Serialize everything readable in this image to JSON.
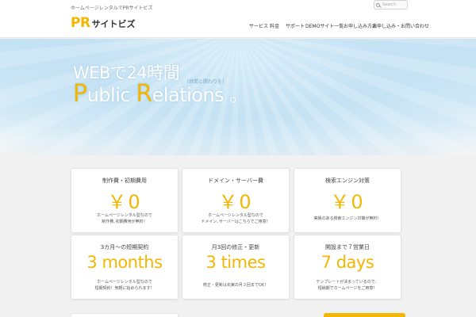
{
  "header": {
    "tagline": "ホームページレンタルでPRサイトビズ",
    "logo_pr": "PR",
    "logo_rest": "サイトビズ",
    "search_placeholder": "Search"
  },
  "nav": {
    "items": [
      {
        "label": "サービス"
      },
      {
        "label": "料金"
      },
      {
        "label": "サポート"
      },
      {
        "label": "DEMOサイト一覧"
      },
      {
        "label": "お申し込み方法"
      },
      {
        "label": "お申し込み・お問い合わせ"
      }
    ]
  },
  "hero": {
    "line1": "WEBで24時間",
    "note": "（世間と関わりを）",
    "line2_p": "P",
    "line2_a": "ublic ",
    "line2_r": "R",
    "line2_b": "elations 。"
  },
  "cards": [
    {
      "title": "制作費・初期費用",
      "value": "￥0",
      "desc1": "ホームページレンタル型なので",
      "desc2": "制作費､初期費用が無料！"
    },
    {
      "title": "ドメイン・サーバー費",
      "value": "￥0",
      "desc1": "ホームページレンタル型なので",
      "desc2": "ドメイン､サーバーはこちらでご用意！"
    },
    {
      "title": "検索エンジン対策",
      "value": "￥0",
      "desc1": "実績のある検索エンジン対策が無料！",
      "desc2": ""
    },
    {
      "title": "3カ月〜の短期契約",
      "value": "3 months",
      "desc1": "ホームページレンタル型なので",
      "desc2": "短期契約！気軽に始められます！"
    },
    {
      "title": "月3回の修正・更新",
      "value": "3 times",
      "desc1": "修正・更新は充実の月３回までOK！",
      "desc2": ""
    },
    {
      "title": "開設まで７営業日",
      "value": "7 days",
      "desc1": "テンプレートが決まっているので、",
      "desc2": "短納期でホームページをご用意！"
    }
  ],
  "colors": {
    "accent": "#f2b705",
    "hero_sky": "#c4e2f4",
    "background": "#f1f1f1"
  },
  "icons": {
    "search": "search-icon"
  }
}
